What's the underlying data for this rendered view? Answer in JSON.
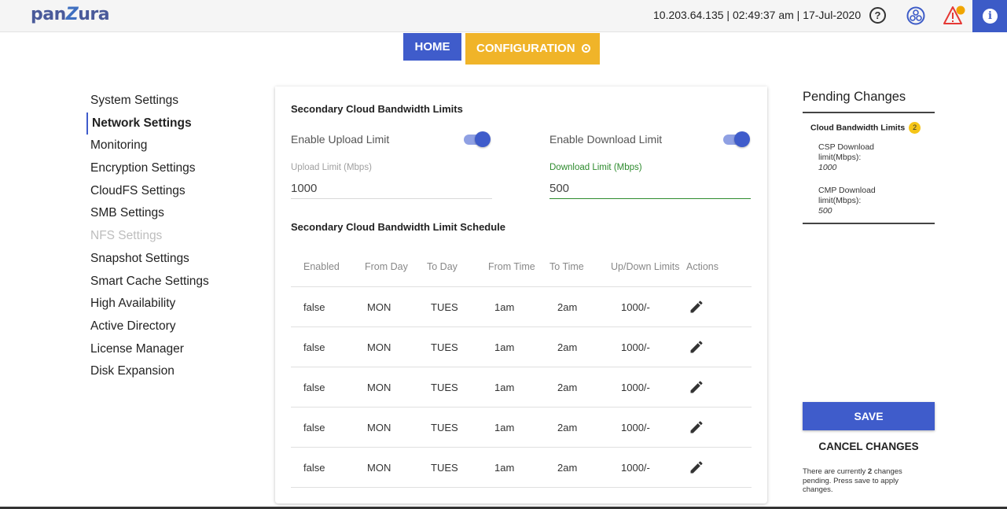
{
  "header": {
    "logo_prefix": "pan",
    "logo_z": "Z",
    "logo_suffix": "ura",
    "status": "10.203.64.135 | 02:49:37 am | 17-Jul-2020",
    "help_glyph": "?",
    "info_glyph": "i",
    "icons": [
      "help-icon",
      "hub-icon",
      "alert-icon",
      "info-icon"
    ]
  },
  "nav": {
    "home": "HOME",
    "configuration": "CONFIGURATION"
  },
  "sidebar": {
    "items": [
      {
        "label": "System Settings",
        "state": "normal"
      },
      {
        "label": "Network Settings",
        "state": "active"
      },
      {
        "label": "Monitoring",
        "state": "normal"
      },
      {
        "label": "Encryption Settings",
        "state": "normal"
      },
      {
        "label": "CloudFS Settings",
        "state": "normal"
      },
      {
        "label": "SMB Settings",
        "state": "normal"
      },
      {
        "label": "NFS Settings",
        "state": "disabled"
      },
      {
        "label": "Snapshot Settings",
        "state": "normal"
      },
      {
        "label": "Smart Cache Settings",
        "state": "normal"
      },
      {
        "label": "High Availability",
        "state": "normal"
      },
      {
        "label": "Active Directory",
        "state": "normal"
      },
      {
        "label": "License Manager",
        "state": "normal"
      },
      {
        "label": "Disk Expansion",
        "state": "normal"
      }
    ]
  },
  "main": {
    "limits_title": "Secondary Cloud Bandwidth Limits",
    "upload_toggle_label": "Enable Upload Limit",
    "upload_toggle_on": true,
    "download_toggle_label": "Enable Download Limit",
    "download_toggle_on": true,
    "upload_field_label": "Upload Limit (Mbps)",
    "upload_field_value": "1000",
    "download_field_label": "Download Limit (Mbps)",
    "download_field_value": "500",
    "schedule_title": "Secondary Cloud Bandwidth Limit Schedule",
    "table": {
      "headers": [
        "Enabled",
        "From Day",
        "To Day",
        "From Time",
        "To Time",
        "Up/Down Limits",
        "Actions"
      ],
      "rows": [
        [
          "false",
          "MON",
          "TUES",
          "1am",
          "2am",
          "1000/-"
        ],
        [
          "false",
          "MON",
          "TUES",
          "1am",
          "2am",
          "1000/-"
        ],
        [
          "false",
          "MON",
          "TUES",
          "1am",
          "2am",
          "1000/-"
        ],
        [
          "false",
          "MON",
          "TUES",
          "1am",
          "2am",
          "1000/-"
        ],
        [
          "false",
          "MON",
          "TUES",
          "1am",
          "2am",
          "1000/-"
        ]
      ]
    }
  },
  "pending": {
    "title": "Pending Changes",
    "group_label": "Cloud Bandwidth Limits",
    "group_count": "2",
    "items": [
      {
        "label": "CSP Download limit(Mbps):",
        "value": "1000"
      },
      {
        "label": "CMP Download limit(Mbps):",
        "value": "500"
      }
    ],
    "save_label": "SAVE",
    "cancel_label": "CANCEL CHANGES",
    "note_prefix": "There are currently ",
    "note_count": "2",
    "note_suffix": " changes pending. Press save to apply changes."
  },
  "colors": {
    "primary": "#3f5ccb",
    "accent": "#f0b429",
    "focus": "#2e8b2e",
    "alert": "#e53935",
    "badge": "#f5c518"
  }
}
